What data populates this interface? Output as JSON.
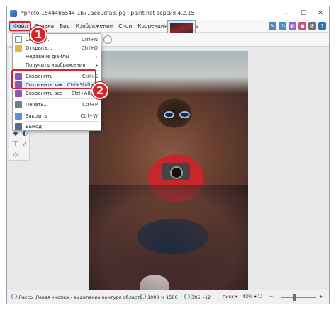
{
  "title_bar": {
    "title": "*photo-1544465544-1b71aee9dfa3.jpg - paint.net версия 4.2.15",
    "minimize": "—",
    "maximize": "☐",
    "close": "✕"
  },
  "menu": {
    "items": [
      "Файл",
      "Правка",
      "Вид",
      "Изображение",
      "Слои",
      "Коррекция",
      "Эффекты"
    ]
  },
  "file_menu": {
    "items": [
      {
        "label": "Создать...",
        "shortcut": "Ctrl+N",
        "icon": "new-file-icon"
      },
      {
        "label": "Открыть...",
        "shortcut": "Ctrl+O",
        "icon": "open-folder-icon"
      },
      {
        "label": "Недавние файлы",
        "shortcut": "",
        "icon": "",
        "submenu": "▸"
      },
      {
        "label": "Получить изображения",
        "shortcut": "",
        "icon": "",
        "submenu": "▸"
      },
      {
        "label": "Сохранить",
        "shortcut": "Ctrl+S",
        "icon": "save-icon"
      },
      {
        "label": "Сохранить как...",
        "shortcut": "Ctrl+Shift+S",
        "icon": "save-as-icon"
      },
      {
        "label": "Сохранить все",
        "shortcut": "Ctrl+Alt+S",
        "icon": "save-all-icon"
      },
      {
        "label": "Печать...",
        "shortcut": "Ctrl+P",
        "icon": "print-icon"
      },
      {
        "label": "Закрыть",
        "shortcut": "Ctrl+W",
        "icon": "close-doc-icon"
      },
      {
        "label": "Выход",
        "shortcut": "",
        "icon": "exit-icon"
      }
    ]
  },
  "annotations": {
    "step1": "1",
    "step2": "2"
  },
  "status_bar": {
    "hint": "Лассо. Левая кнопка - выделение контура области.",
    "image_size": "1000 × 1500",
    "cursor_pos": "385, -12",
    "units": "пикс",
    "zoom": "43%"
  },
  "colors": {
    "highlight_red": "#d8232a",
    "menu_active": "#cce4f7"
  }
}
